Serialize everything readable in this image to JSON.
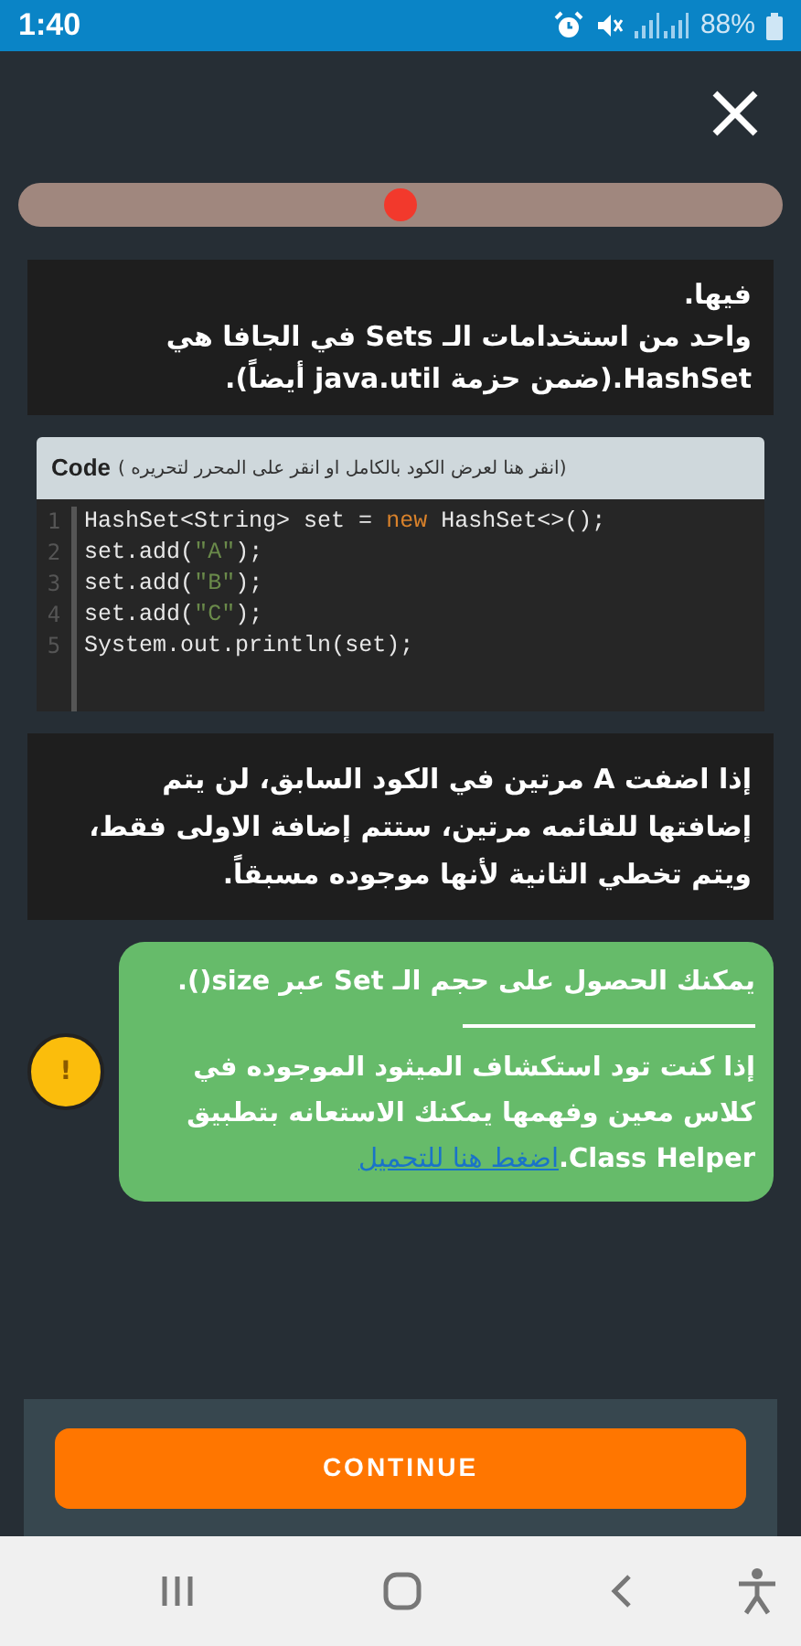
{
  "status_bar": {
    "time": "1:40",
    "battery": "88%"
  },
  "progress": {
    "level": 0.5
  },
  "intro_card": {
    "paragraphs": [
      "فيها.",
      "واحد من استخدامات الـ **Sets** في الجافا هي **HashSet**.(ضمن حزمة **java.util** أيضاً)."
    ]
  },
  "code_block": {
    "title": "Code",
    "hint": "(انقر هنا لعرض الكود بالكامل او انقر على المحرر لتحريره )",
    "lines": [
      {
        "number": "1",
        "text": "HashSet<String> set = new HashSet<>();"
      },
      {
        "number": "2",
        "text": "set.add(\"A\");"
      },
      {
        "number": "3",
        "text": "set.add(\"B\");"
      },
      {
        "number": "4",
        "text": "set.add(\"C\");"
      },
      {
        "number": "5",
        "text": "System.out.println(set);"
      }
    ]
  },
  "note_card": {
    "text": "إذا اضفت **A** مرتين في الكود السابق، لن يتم إضافتها للقائمه مرتين، ستتم إضافة الاولى فقط، ويتم تخطي الثانية لأنها موجوده مسبقاً."
  },
  "tip": {
    "badge": "!",
    "first": "يمكنك الحصول على حجم الـ **Set** عبر **size()**.",
    "second": "إذا كنت تود استكشاف الميثود الموجوده في كلاس معين وفهمها يمكنك الاستعانه بتطبيق **Class Helper**.",
    "link": "اضغط هنا للتحميل"
  },
  "continue_button": "CONTINUE"
}
